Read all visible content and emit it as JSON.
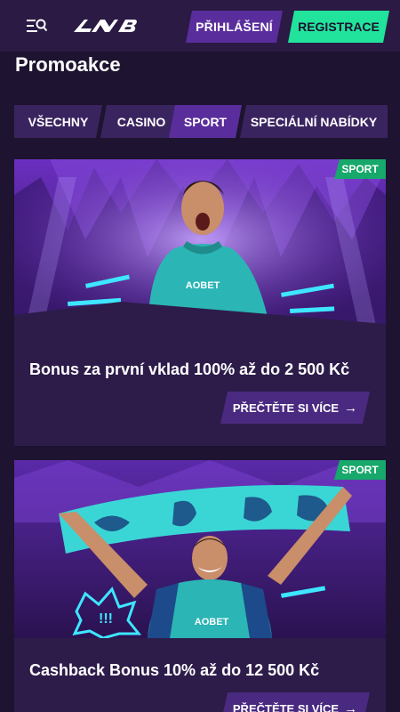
{
  "header": {
    "login_label": "PŘIHLÁŠENÍ",
    "register_label": "REGISTRACE",
    "menu_icon": "menu-search-icon",
    "logo_icon": "nb-logo"
  },
  "page": {
    "title": "Promoakce"
  },
  "tabs": [
    {
      "label": "VŠECHNY",
      "active": false
    },
    {
      "label": "CASINO",
      "active": false
    },
    {
      "label": "SPORT",
      "active": true
    },
    {
      "label": "SPECIÁLNÍ NABÍDKY",
      "active": false
    }
  ],
  "promos": [
    {
      "badge": "SPORT",
      "title": "Bonus za první vklad 100% až do 2 500 Kč",
      "button": "PŘEČTĚTE SI VÍCE",
      "shirt_text": "AOBET"
    },
    {
      "badge": "SPORT",
      "title": "Cashback Bonus 10% až do 12 500 Kč",
      "button": "PŘEČTĚTE SI VÍCE",
      "shirt_text": "AOBET",
      "sticker_text": "!!!"
    }
  ],
  "colors": {
    "background": "#1e1330",
    "header": "#2a1a44",
    "accent_purple": "#5a2d9c",
    "accent_green": "#22e39b",
    "badge_green": "#17a86b"
  }
}
